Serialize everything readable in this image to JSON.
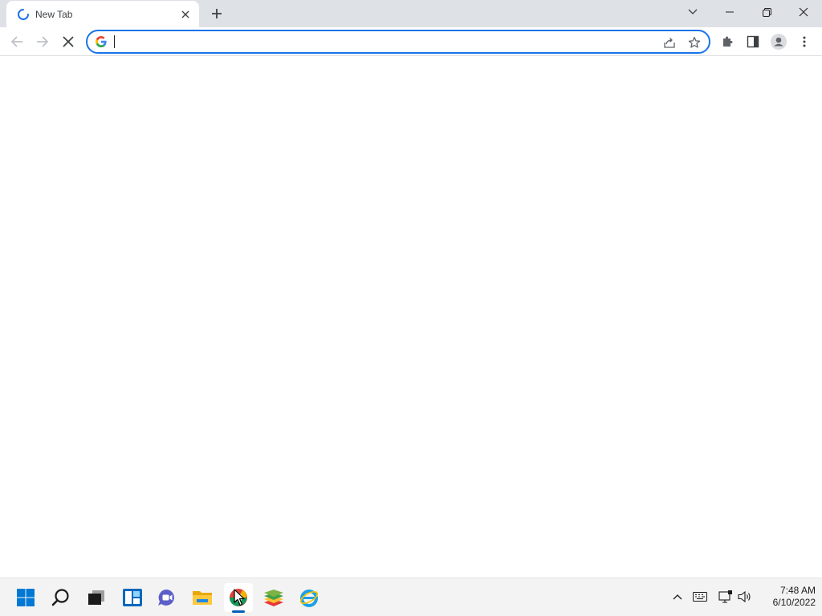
{
  "browser": {
    "tab": {
      "title": "New Tab",
      "state": "loading"
    },
    "omnibox": {
      "value": "",
      "placeholder": "",
      "search_engine_icon": "google-g-icon"
    },
    "toolbar_icons": [
      "back-arrow-icon",
      "forward-arrow-icon",
      "stop-icon",
      "share-icon",
      "star-icon",
      "extensions-puzzle-icon",
      "side-panel-icon",
      "profile-icon",
      "kebab-menu-icon"
    ],
    "window_controls": [
      "tab-search-chevron-icon",
      "minimize-icon",
      "restore-icon",
      "close-icon"
    ],
    "accent_color": "#1a73e8"
  },
  "taskbar": {
    "apps": [
      "windows-start-icon",
      "search-icon",
      "task-view-icon",
      "widgets-icon",
      "teams-chat-icon",
      "file-explorer-icon",
      "chrome-icon",
      "bluestacks-icon",
      "internet-explorer-icon"
    ],
    "active_app": "chrome-icon",
    "tray_icons": [
      "chevron-up-icon",
      "keyboard-icon",
      "network-icon",
      "volume-icon"
    ],
    "clock": {
      "time": "7:48 AM",
      "date": "6/10/2022"
    }
  }
}
